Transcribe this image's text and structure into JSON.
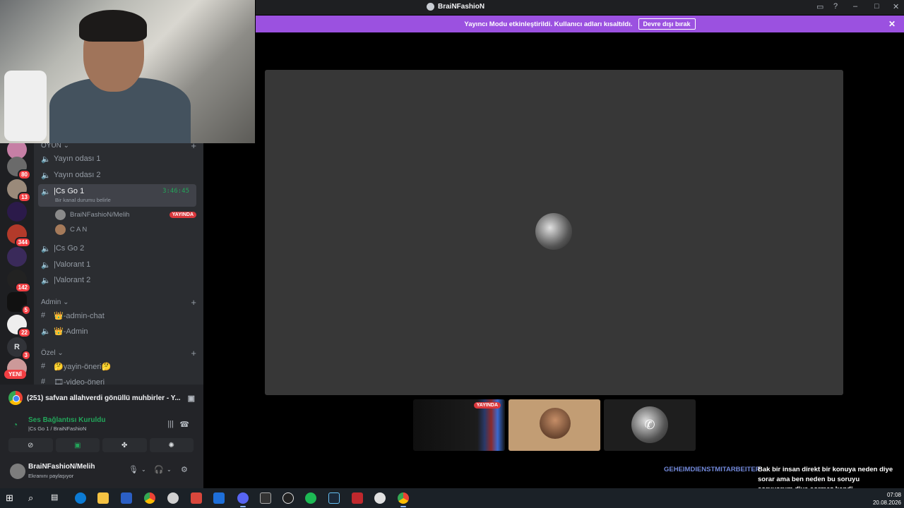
{
  "window": {
    "title": "BraiNFashioN",
    "colors": {
      "accent_purple": "#9b51e0",
      "voice_green": "#23a55a",
      "live_red": "#da373c",
      "chat_name": "#7289da"
    }
  },
  "streamer_banner": {
    "message": "Yayıncı Modu etkinleştirildi. Kullanıcı adları kısaltıldı.",
    "button_label": "Devre dışı bırak",
    "close_icon": "close-icon"
  },
  "servers": {
    "badges": [
      "80",
      "13",
      "344",
      "142",
      "5",
      "22",
      "3"
    ],
    "letter_server": "R",
    "new_pill": "YENİ"
  },
  "sidebar": {
    "categories": {
      "game": "OYUN",
      "admin": "Admin",
      "private": "Özel"
    },
    "channels": {
      "yayin1": "Yayın odası 1",
      "yayin2": "Yayın odası 2",
      "csgo1": "|Cs Go 1",
      "csgo1_timer": "3:46:45",
      "csgo1_status": "Bir kanal durumu belirle",
      "csgo2": "|Cs Go 2",
      "valorant1": "|Valorant 1",
      "valorant2": "|Valorant 2",
      "admin_chat": "👑-admin-chat",
      "admin_voice": "👑-Admin",
      "yayin_oneri": "🤔yayin-öneri🤔",
      "video_oneri": "🎞-video-öneri"
    },
    "voice_users": [
      {
        "name": "BraiNFashioN/Melih",
        "live": "YAYINDA"
      },
      {
        "name": "C A N"
      }
    ]
  },
  "panel": {
    "activity": "(251) safvan allahverdi gönüllü muhbirler - Y...",
    "voice_title": "Ses Bağlantısı Kuruldu",
    "voice_sub": "|Cs Go 1 / BraiNFashioN",
    "username": "BraiNFashioN/Melih",
    "user_status": "Ekranını paylaşıyor"
  },
  "stage": {
    "thumbnails": [
      {
        "live": "YAYINDA"
      }
    ]
  },
  "chat": {
    "author": "GEHEIMDIENSTMITARBEITER",
    "message": "Bak bir insan direkt bir konuya neden diye sorar ama ben neden bu soruyu soruyorum diye sormaz kendi düşüncelerini kimse tam objektif şekilde denetleyemez"
  },
  "taskbar": {
    "time": "07:08",
    "date": "20.08.2026"
  }
}
